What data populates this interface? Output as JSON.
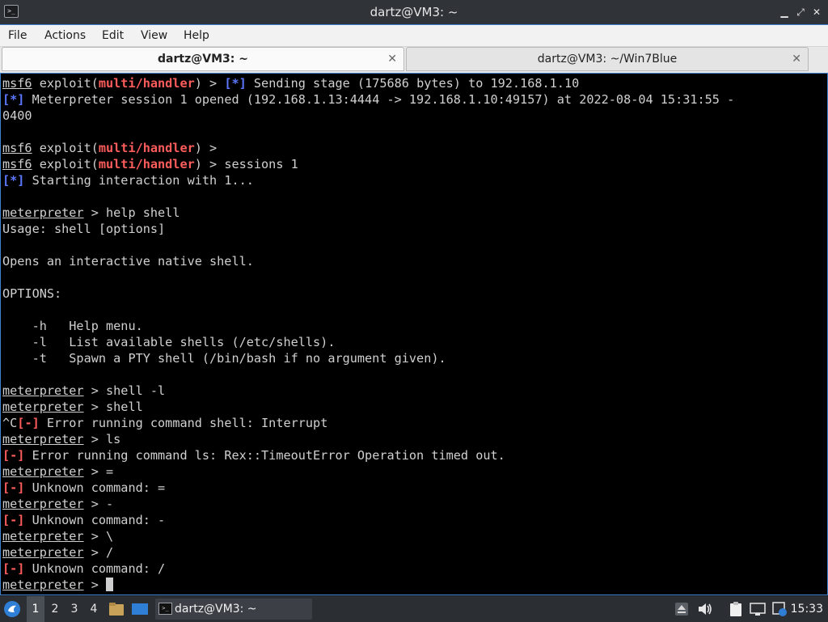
{
  "window": {
    "title": "dartz@VM3: ~",
    "minimize_glyph": "▁",
    "maximize_glyph": "⤢",
    "close_glyph": "✕"
  },
  "menu": {
    "file": "File",
    "actions": "Actions",
    "edit": "Edit",
    "view": "View",
    "help": "Help"
  },
  "tabs": [
    {
      "label": "dartz@VM3: ~",
      "active": true,
      "close": "✕"
    },
    {
      "label": "dartz@VM3: ~/Win7Blue",
      "active": false,
      "close": "✕"
    }
  ],
  "terminal": {
    "lines": [
      [
        {
          "t": "msf6",
          "c": "u"
        },
        {
          "t": " exploit("
        },
        {
          "t": "multi/handler",
          "c": "r"
        },
        {
          "t": ") > "
        },
        {
          "t": "[*]",
          "c": "b"
        },
        {
          "t": " Sending stage (175686 bytes) to 192.168.1.10"
        }
      ],
      [
        {
          "t": "[*]",
          "c": "b"
        },
        {
          "t": " Meterpreter session 1 opened (192.168.1.13:4444 -> 192.168.1.10:49157) at 2022-08-04 15:31:55 -"
        }
      ],
      [
        {
          "t": "0400"
        }
      ],
      [],
      [
        {
          "t": "msf6",
          "c": "u"
        },
        {
          "t": " exploit("
        },
        {
          "t": "multi/handler",
          "c": "r"
        },
        {
          "t": ") >"
        }
      ],
      [
        {
          "t": "msf6",
          "c": "u"
        },
        {
          "t": " exploit("
        },
        {
          "t": "multi/handler",
          "c": "r"
        },
        {
          "t": ") > sessions 1"
        }
      ],
      [
        {
          "t": "[*]",
          "c": "b"
        },
        {
          "t": " Starting interaction with 1..."
        }
      ],
      [],
      [
        {
          "t": "meterpreter",
          "c": "u"
        },
        {
          "t": " > help shell"
        }
      ],
      [
        {
          "t": "Usage: shell [options]"
        }
      ],
      [],
      [
        {
          "t": "Opens an interactive native shell."
        }
      ],
      [],
      [
        {
          "t": "OPTIONS:"
        }
      ],
      [],
      [
        {
          "t": "    -h   Help menu."
        }
      ],
      [
        {
          "t": "    -l   List available shells (/etc/shells)."
        }
      ],
      [
        {
          "t": "    -t   Spawn a PTY shell (/bin/bash if no argument given)."
        }
      ],
      [],
      [
        {
          "t": "meterpreter",
          "c": "u"
        },
        {
          "t": " > shell -l"
        }
      ],
      [
        {
          "t": "meterpreter",
          "c": "u"
        },
        {
          "t": " > shell"
        }
      ],
      [
        {
          "t": "^C"
        },
        {
          "t": "[-]",
          "c": "r"
        },
        {
          "t": " Error running command shell: Interrupt"
        }
      ],
      [
        {
          "t": "meterpreter",
          "c": "u"
        },
        {
          "t": " > ls"
        }
      ],
      [
        {
          "t": "[-]",
          "c": "r"
        },
        {
          "t": " Error running command ls: Rex::TimeoutError Operation timed out."
        }
      ],
      [
        {
          "t": "meterpreter",
          "c": "u"
        },
        {
          "t": " > ="
        }
      ],
      [
        {
          "t": "[-]",
          "c": "r"
        },
        {
          "t": " Unknown command: ="
        }
      ],
      [
        {
          "t": "meterpreter",
          "c": "u"
        },
        {
          "t": " > -"
        }
      ],
      [
        {
          "t": "[-]",
          "c": "r"
        },
        {
          "t": " Unknown command: -"
        }
      ],
      [
        {
          "t": "meterpreter",
          "c": "u"
        },
        {
          "t": " > \\"
        }
      ],
      [
        {
          "t": "meterpreter",
          "c": "u"
        },
        {
          "t": " > /"
        }
      ],
      [
        {
          "t": "[-]",
          "c": "r"
        },
        {
          "t": " Unknown command: /"
        }
      ],
      [
        {
          "t": "meterpreter",
          "c": "u"
        },
        {
          "t": " > "
        },
        {
          "cursor": true
        }
      ]
    ]
  },
  "taskbar": {
    "workspaces": [
      "1",
      "2",
      "3",
      "4"
    ],
    "active_workspace": "1",
    "task_label": "dartz@VM3: ~",
    "clock": "15:33"
  },
  "colors": {
    "prompt_red": "#ff5c5c",
    "status_blue": "#5c78ff",
    "focus_border": "#3f7fd0"
  }
}
